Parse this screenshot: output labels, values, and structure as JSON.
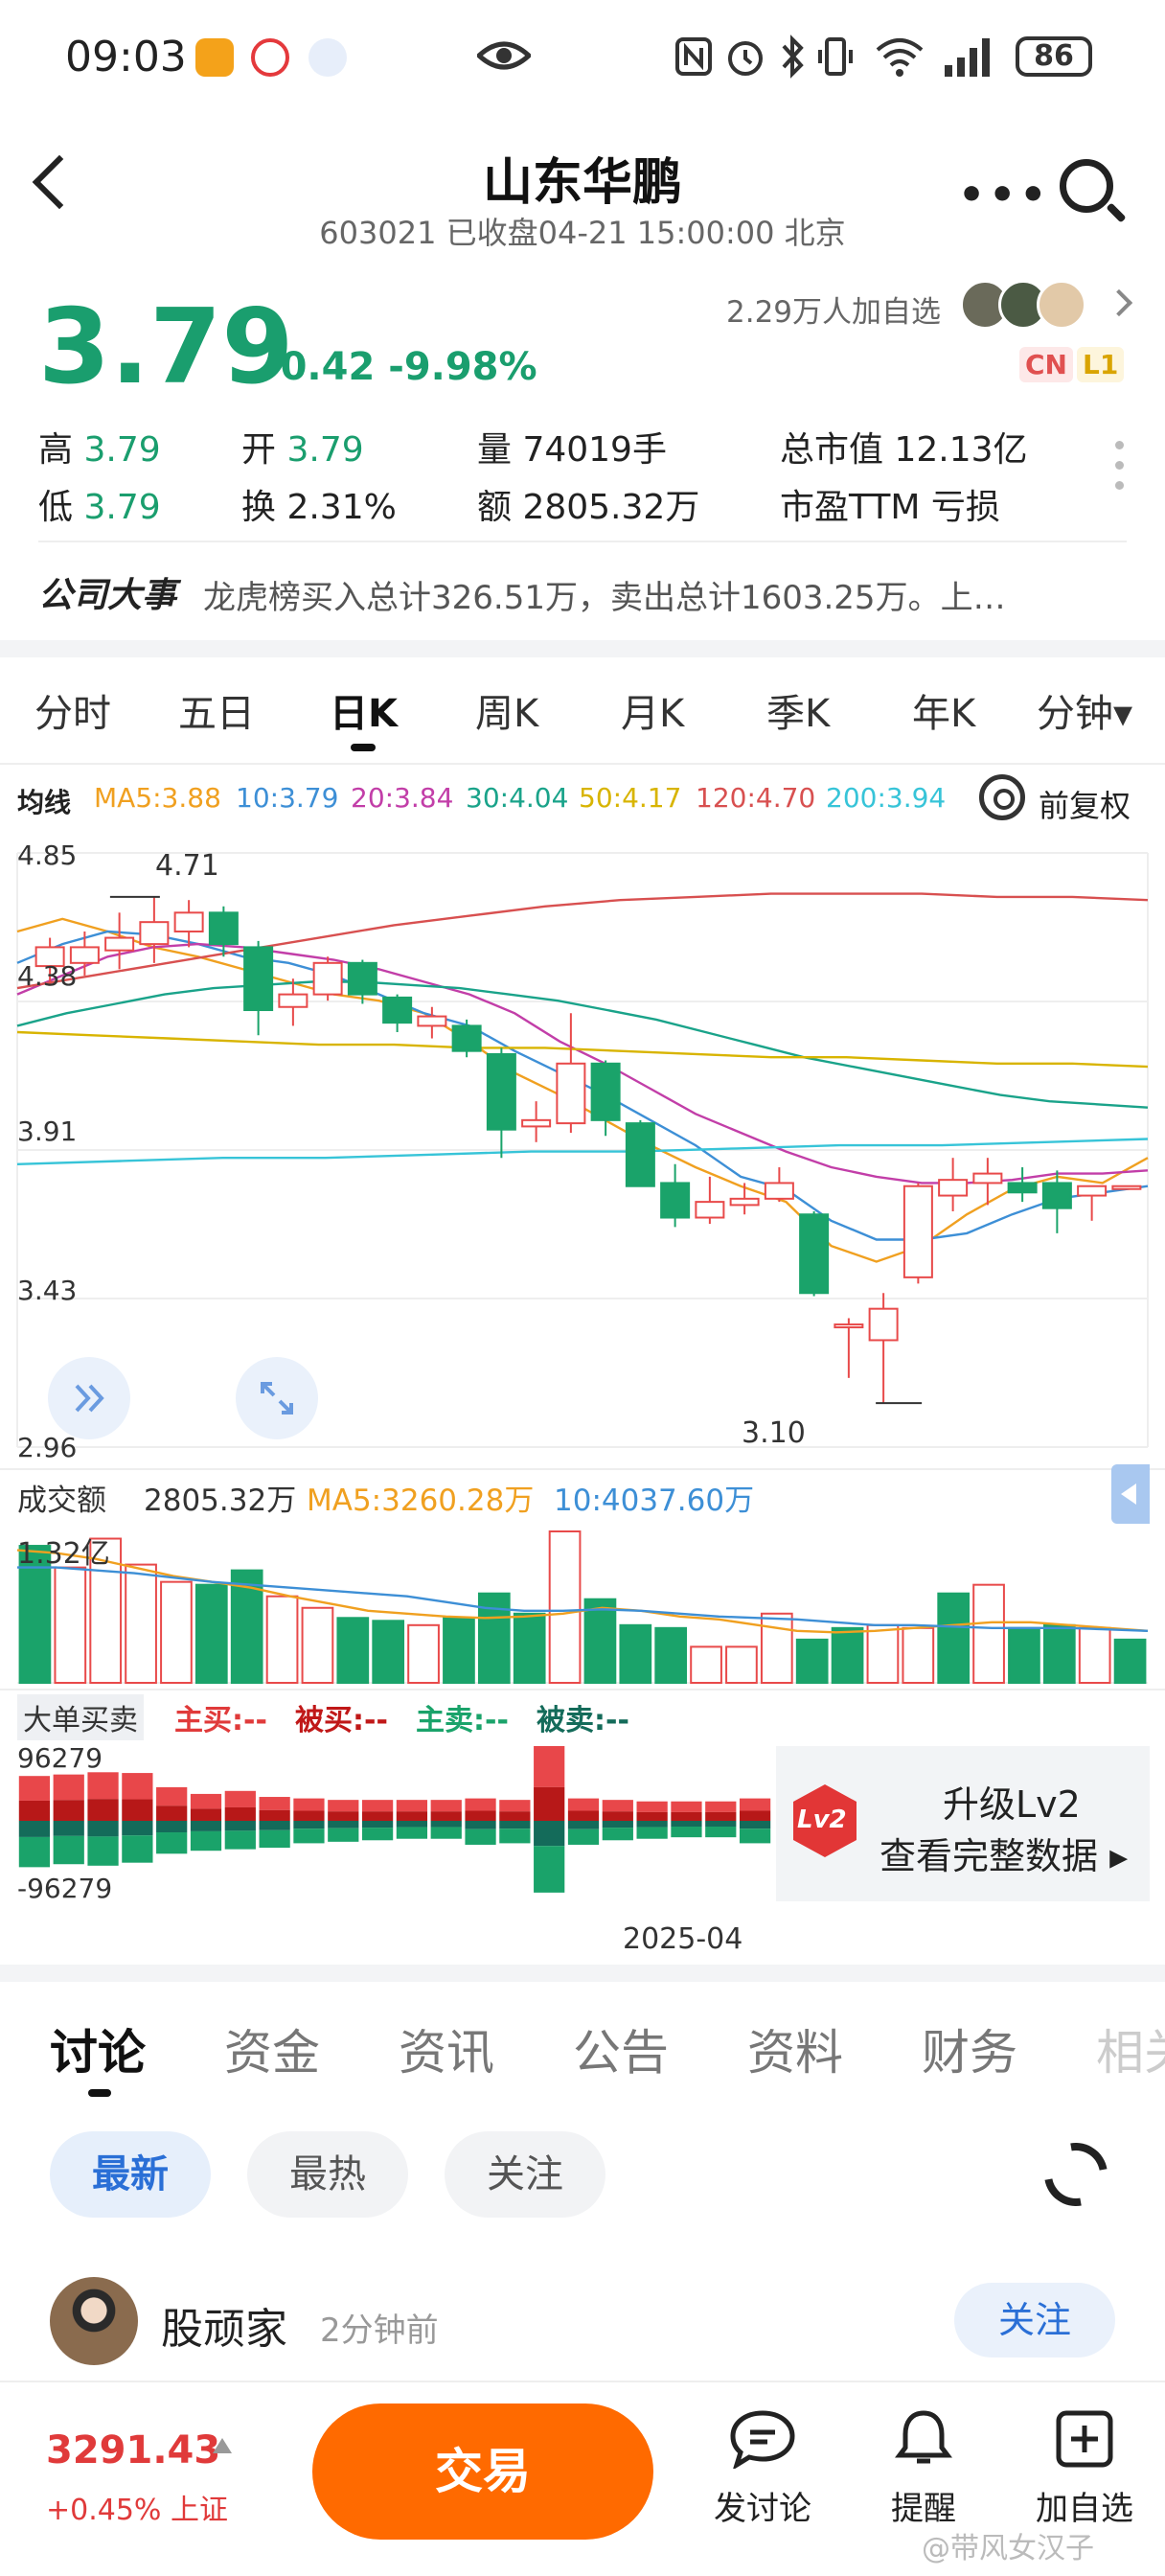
{
  "status_bar": {
    "time": "09:03",
    "battery": "86"
  },
  "header": {
    "title": "山东华鹏",
    "subtitle": "603021 已收盘04-21 15:00:00 北京"
  },
  "quote": {
    "price": "3.79",
    "change": "-0.42 -9.98%",
    "followers": "2.29万人加自选",
    "badge_cn": "CN",
    "badge_l1": "L1",
    "stats": {
      "high_label": "高",
      "high_value": "3.79",
      "open_label": "开",
      "open_value": "3.79",
      "volume": "量 74019手",
      "market_cap": "总市值 12.13亿",
      "low_label": "低",
      "low_value": "3.79",
      "turnover": "换 2.31%",
      "amount": "额 2805.32万",
      "pe": "市盈TTM 亏损"
    }
  },
  "news": {
    "label": "公司大事",
    "text": "龙虎榜买入总计326.51万，卖出总计1603.25万。上…"
  },
  "period_tabs": [
    "分时",
    "五日",
    "日K",
    "周K",
    "月K",
    "季K",
    "年K",
    "分钟▾"
  ],
  "active_period": 2,
  "ma": {
    "label": "均线",
    "items": [
      {
        "text": "MA5:3.88",
        "color": "#f0a020"
      },
      {
        "text": "10:3.79",
        "color": "#3d8fd6"
      },
      {
        "text": "20:3.84",
        "color": "#c23ea8"
      },
      {
        "text": "30:4.04",
        "color": "#1aa38a"
      },
      {
        "text": "50:4.17",
        "color": "#d8b400"
      },
      {
        "text": "120:4.70",
        "color": "#d85050"
      },
      {
        "text": "200:3.94",
        "color": "#37c4d8"
      }
    ],
    "fq_label": "前复权"
  },
  "chart_data": {
    "type": "candlestick",
    "y_ticks": [
      "4.85",
      "4.38",
      "3.91",
      "3.43",
      "2.96"
    ],
    "ylim": [
      2.96,
      4.85
    ],
    "high_annotation": "4.71",
    "low_annotation": "3.10",
    "x_tick": "2025-04",
    "candles": [
      {
        "o": 4.49,
        "c": 4.55,
        "h": 4.58,
        "l": 4.43
      },
      {
        "o": 4.5,
        "c": 4.55,
        "h": 4.6,
        "l": 4.46
      },
      {
        "o": 4.54,
        "c": 4.58,
        "h": 4.66,
        "l": 4.48
      },
      {
        "o": 4.56,
        "c": 4.63,
        "h": 4.71,
        "l": 4.5
      },
      {
        "o": 4.6,
        "c": 4.66,
        "h": 4.7,
        "l": 4.55
      },
      {
        "o": 4.66,
        "c": 4.56,
        "h": 4.68,
        "l": 4.52
      },
      {
        "o": 4.55,
        "c": 4.35,
        "h": 4.57,
        "l": 4.27
      },
      {
        "o": 4.36,
        "c": 4.4,
        "h": 4.45,
        "l": 4.3
      },
      {
        "o": 4.4,
        "c": 4.5,
        "h": 4.52,
        "l": 4.38
      },
      {
        "o": 4.5,
        "c": 4.4,
        "h": 4.51,
        "l": 4.37
      },
      {
        "o": 4.39,
        "c": 4.31,
        "h": 4.4,
        "l": 4.28
      },
      {
        "o": 4.3,
        "c": 4.33,
        "h": 4.36,
        "l": 4.26
      },
      {
        "o": 4.3,
        "c": 4.22,
        "h": 4.32,
        "l": 4.2
      },
      {
        "o": 4.21,
        "c": 3.97,
        "h": 4.23,
        "l": 3.88
      },
      {
        "o": 3.98,
        "c": 4.0,
        "h": 4.06,
        "l": 3.93
      },
      {
        "o": 3.99,
        "c": 4.18,
        "h": 4.34,
        "l": 3.96
      },
      {
        "o": 4.18,
        "c": 4.0,
        "h": 4.19,
        "l": 3.95
      },
      {
        "o": 3.99,
        "c": 3.79,
        "h": 4.0,
        "l": 3.79
      },
      {
        "o": 3.8,
        "c": 3.69,
        "h": 3.86,
        "l": 3.66
      },
      {
        "o": 3.69,
        "c": 3.74,
        "h": 3.82,
        "l": 3.67
      },
      {
        "o": 3.73,
        "c": 3.75,
        "h": 3.8,
        "l": 3.7
      },
      {
        "o": 3.75,
        "c": 3.8,
        "h": 3.85,
        "l": 3.74
      },
      {
        "o": 3.7,
        "c": 3.45,
        "h": 3.71,
        "l": 3.44
      },
      {
        "o": 3.35,
        "c": 3.35,
        "h": 3.37,
        "l": 3.18
      },
      {
        "o": 3.3,
        "c": 3.4,
        "h": 3.45,
        "l": 3.1
      },
      {
        "o": 3.5,
        "c": 3.79,
        "h": 3.8,
        "l": 3.48
      },
      {
        "o": 3.76,
        "c": 3.81,
        "h": 3.88,
        "l": 3.71
      },
      {
        "o": 3.8,
        "c": 3.83,
        "h": 3.88,
        "l": 3.73
      },
      {
        "o": 3.8,
        "c": 3.77,
        "h": 3.85,
        "l": 3.74
      },
      {
        "o": 3.8,
        "c": 3.72,
        "h": 3.84,
        "l": 3.64
      },
      {
        "o": 3.76,
        "c": 3.79,
        "h": 3.79,
        "l": 3.68
      },
      {
        "o": 3.79,
        "c": 3.79,
        "h": 3.79,
        "l": 3.79
      }
    ],
    "ma_series": [
      {
        "name": "MA5",
        "color": "#f0a020",
        "values": [
          4.6,
          4.64,
          4.6,
          4.55,
          4.52,
          4.48,
          4.44,
          4.4,
          4.38,
          4.34,
          4.25,
          4.15,
          4.08,
          4.0,
          3.92,
          3.85,
          3.79,
          3.74,
          3.6,
          3.55,
          3.6,
          3.7,
          3.78,
          3.82,
          3.8,
          3.88
        ]
      },
      {
        "name": "MA10",
        "color": "#3d8fd6",
        "values": [
          4.5,
          4.56,
          4.6,
          4.59,
          4.56,
          4.52,
          4.5,
          4.46,
          4.4,
          4.34,
          4.3,
          4.22,
          4.15,
          4.08,
          4.0,
          3.92,
          3.82,
          3.78,
          3.68,
          3.62,
          3.62,
          3.64,
          3.7,
          3.75,
          3.77,
          3.79
        ]
      },
      {
        "name": "MA20",
        "color": "#c23ea8",
        "values": [
          4.4,
          4.46,
          4.52,
          4.55,
          4.56,
          4.55,
          4.53,
          4.51,
          4.48,
          4.44,
          4.4,
          4.34,
          4.25,
          4.18,
          4.1,
          4.02,
          3.96,
          3.9,
          3.85,
          3.82,
          3.8,
          3.8,
          3.81,
          3.83,
          3.83,
          3.84
        ]
      },
      {
        "name": "MA30",
        "color": "#1aa38a",
        "values": [
          4.3,
          4.34,
          4.37,
          4.4,
          4.42,
          4.43,
          4.44,
          4.44,
          4.43,
          4.42,
          4.4,
          4.38,
          4.35,
          4.32,
          4.28,
          4.24,
          4.2,
          4.17,
          4.14,
          4.11,
          4.08,
          4.06,
          4.05,
          4.04
        ]
      },
      {
        "name": "MA50",
        "color": "#d8b400",
        "values": [
          4.28,
          4.27,
          4.26,
          4.25,
          4.24,
          4.24,
          4.23,
          4.23,
          4.22,
          4.21,
          4.2,
          4.2,
          4.19,
          4.18,
          4.18,
          4.17
        ]
      },
      {
        "name": "MA120",
        "color": "#d85050",
        "values": [
          4.42,
          4.46,
          4.5,
          4.54,
          4.58,
          4.62,
          4.65,
          4.68,
          4.7,
          4.71,
          4.72,
          4.72,
          4.72,
          4.71,
          4.71,
          4.7
        ]
      },
      {
        "name": "MA200",
        "color": "#37c4d8",
        "values": [
          3.86,
          3.87,
          3.88,
          3.88,
          3.89,
          3.9,
          3.9,
          3.91,
          3.92,
          3.92,
          3.93,
          3.94
        ]
      }
    ],
    "volume": {
      "label": "成交额",
      "current": "2805.32万",
      "ma5_label": "MA5:3260.28万",
      "ma10_label": "10:4037.60万",
      "max_label": "1.32亿",
      "bars": [
        {
          "v": 0.95,
          "up": false
        },
        {
          "v": 0.8,
          "up": true
        },
        {
          "v": 1.0,
          "up": true
        },
        {
          "v": 0.82,
          "up": true
        },
        {
          "v": 0.7,
          "up": true
        },
        {
          "v": 0.68,
          "up": false
        },
        {
          "v": 0.78,
          "up": false
        },
        {
          "v": 0.6,
          "up": true
        },
        {
          "v": 0.52,
          "up": true
        },
        {
          "v": 0.45,
          "up": false
        },
        {
          "v": 0.43,
          "up": false
        },
        {
          "v": 0.4,
          "up": true
        },
        {
          "v": 0.45,
          "up": false
        },
        {
          "v": 0.62,
          "up": false
        },
        {
          "v": 0.48,
          "up": false
        },
        {
          "v": 1.05,
          "up": true
        },
        {
          "v": 0.58,
          "up": false
        },
        {
          "v": 0.4,
          "up": false
        },
        {
          "v": 0.38,
          "up": false
        },
        {
          "v": 0.25,
          "up": true
        },
        {
          "v": 0.25,
          "up": true
        },
        {
          "v": 0.48,
          "up": true
        },
        {
          "v": 0.3,
          "up": false
        },
        {
          "v": 0.38,
          "up": false
        },
        {
          "v": 0.4,
          "up": true
        },
        {
          "v": 0.38,
          "up": true
        },
        {
          "v": 0.62,
          "up": false
        },
        {
          "v": 0.68,
          "up": true
        },
        {
          "v": 0.38,
          "up": false
        },
        {
          "v": 0.4,
          "up": false
        },
        {
          "v": 0.38,
          "up": true
        },
        {
          "v": 0.3,
          "up": false
        }
      ],
      "ma_lines": [
        {
          "color": "#f0a020",
          "values": [
            0.92,
            0.9,
            0.86,
            0.8,
            0.74,
            0.7,
            0.66,
            0.6,
            0.55,
            0.5,
            0.48,
            0.46,
            0.45,
            0.46,
            0.48,
            0.52,
            0.5,
            0.46,
            0.44,
            0.4,
            0.36,
            0.35,
            0.36,
            0.38,
            0.4,
            0.42,
            0.42,
            0.4,
            0.38,
            0.36
          ]
        },
        {
          "color": "#3d8fd6",
          "values": [
            0.8,
            0.8,
            0.78,
            0.76,
            0.73,
            0.7,
            0.68,
            0.66,
            0.64,
            0.62,
            0.6,
            0.56,
            0.52,
            0.5,
            0.5,
            0.51,
            0.5,
            0.48,
            0.46,
            0.45,
            0.44,
            0.42,
            0.4,
            0.4,
            0.39,
            0.38,
            0.38,
            0.38,
            0.37,
            0.36
          ]
        }
      ]
    },
    "big_order": {
      "label": "大单买卖",
      "legend": [
        {
          "text": "主买:--",
          "color": "#e03a3a"
        },
        {
          "text": "被买:--",
          "color": "#c01818"
        },
        {
          "text": "主卖:--",
          "color": "#1aa36a"
        },
        {
          "text": "被卖:--",
          "color": "#146b5a"
        }
      ],
      "max_label": "96279",
      "min_label": "-96279",
      "buy": [
        0.6,
        0.62,
        0.65,
        0.64,
        0.45,
        0.36,
        0.4,
        0.32,
        0.3,
        0.28,
        0.28,
        0.28,
        0.28,
        0.3,
        0.28,
        1.0,
        0.3,
        0.28,
        0.26,
        0.26,
        0.26,
        0.3
      ],
      "sell": [
        0.62,
        0.58,
        0.6,
        0.56,
        0.44,
        0.4,
        0.38,
        0.36,
        0.3,
        0.28,
        0.26,
        0.24,
        0.24,
        0.32,
        0.3,
        0.96,
        0.32,
        0.26,
        0.24,
        0.22,
        0.22,
        0.3
      ]
    }
  },
  "lv2": {
    "badge": "Lv2",
    "line1": "升级Lv2",
    "line2": "查看完整数据 ▸"
  },
  "discussion": {
    "tabs": [
      "讨论",
      "资金",
      "资讯",
      "公告",
      "资料",
      "财务",
      "相关"
    ],
    "filters": [
      "最新",
      "最热",
      "关注"
    ],
    "post": {
      "user": "股顽家",
      "time": "2分钟前",
      "follow": "关注"
    }
  },
  "bottom_bar": {
    "index_value": "3291.43",
    "index_change": "+0.45% 上证",
    "trade": "交易",
    "nav": [
      "发讨论",
      "提醒",
      "加自选"
    ]
  },
  "watermark": "@带风女汉子"
}
